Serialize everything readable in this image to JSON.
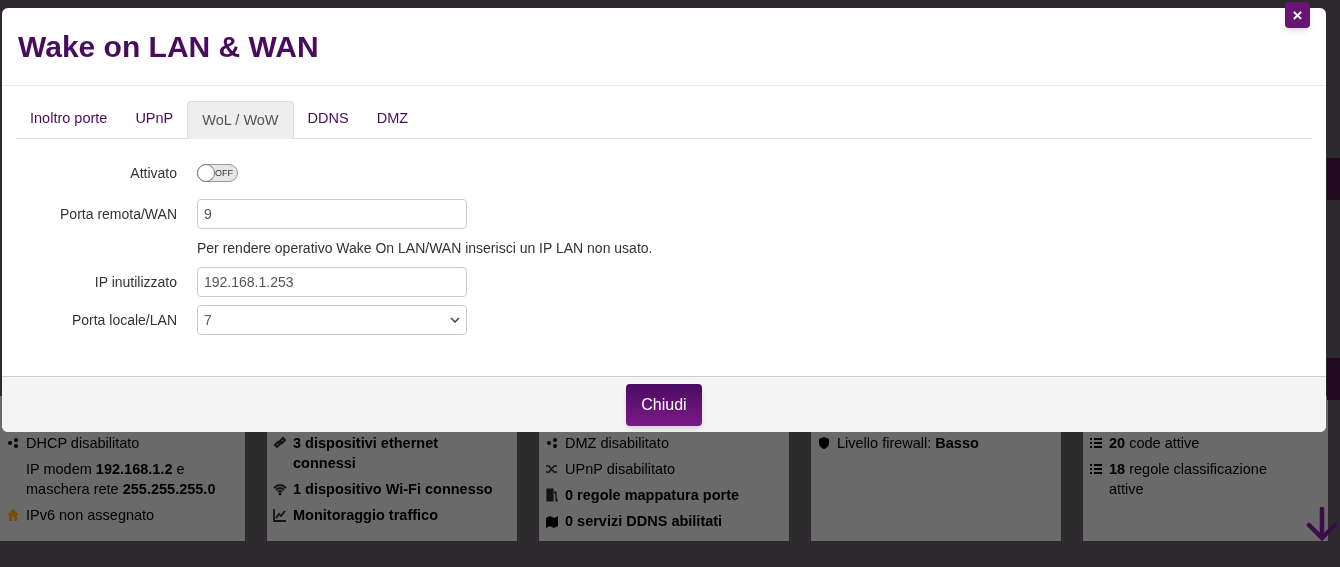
{
  "dialog": {
    "title": "Wake on LAN & WAN",
    "close_button": "×",
    "tabs": [
      {
        "label": "Inoltro porte",
        "selected": false
      },
      {
        "label": "UPnP",
        "selected": false
      },
      {
        "label": "WoL / WoW",
        "selected": true
      },
      {
        "label": "DDNS",
        "selected": false
      },
      {
        "label": "DMZ",
        "selected": false
      }
    ],
    "fields": [
      {
        "kind": "toggle",
        "label": "Attivato",
        "on": false,
        "text": "OFF"
      },
      {
        "kind": "text",
        "label": "Porta remota/WAN",
        "value": "9"
      },
      {
        "kind": "note",
        "text": "Per rendere operativo Wake On LAN/WAN inserisci un IP LAN non usato."
      },
      {
        "kind": "text",
        "label": "IP inutilizzato",
        "value": "192.168.1.253"
      },
      {
        "kind": "select",
        "label": "Porta locale/LAN",
        "value": "7"
      }
    ],
    "footer_button": "Chiudi"
  },
  "background_cards": [
    {
      "lines": [
        {
          "text": "DHCP disabilitato"
        },
        {
          "text": "IP modem **192.168.1.2** e maschera rete **255.255.255.0**"
        },
        {
          "text": "IPv6 non assegnato"
        }
      ]
    },
    {
      "lines": [
        {
          "text": "**3 dispositivi ethernet connessi**"
        },
        {
          "text": "**1 dispositivo Wi-Fi connesso**"
        },
        {
          "text": "**Monitoraggio traffico**"
        }
      ]
    },
    {
      "lines": [
        {
          "text": "DMZ disabilitato"
        },
        {
          "text": "UPnP disabilitato"
        },
        {
          "text": "**0 regole mappatura porte**"
        },
        {
          "text": "**0 servizi DDNS abilitati**"
        }
      ]
    },
    {
      "lines": [
        {
          "text": "Livello firewall: **Basso**"
        }
      ]
    },
    {
      "lines": [
        {
          "text": "**20** code attive"
        },
        {
          "text": "**18** regole classificazione attive"
        }
      ]
    }
  ]
}
